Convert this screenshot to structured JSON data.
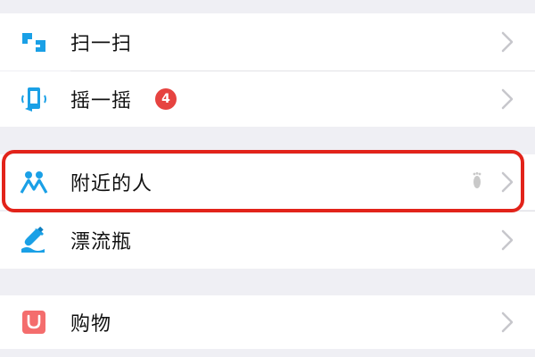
{
  "items": [
    {
      "label": "扫一扫",
      "icon": "scan-icon"
    },
    {
      "label": "摇一摇",
      "icon": "shake-icon",
      "badge": "4"
    },
    {
      "label": "附近的人",
      "icon": "people-nearby-icon",
      "highlighted": true,
      "extra_icon": "footprint-icon"
    },
    {
      "label": "漂流瓶",
      "icon": "drift-bottle-icon"
    },
    {
      "label": "购物",
      "icon": "shopping-bag-icon"
    }
  ],
  "colors": {
    "accent_blue": "#1aa0e6",
    "badge_red": "#e64340",
    "highlight_red": "#e2231a",
    "shop_red": "#f46d6d",
    "background": "#efeff4"
  }
}
